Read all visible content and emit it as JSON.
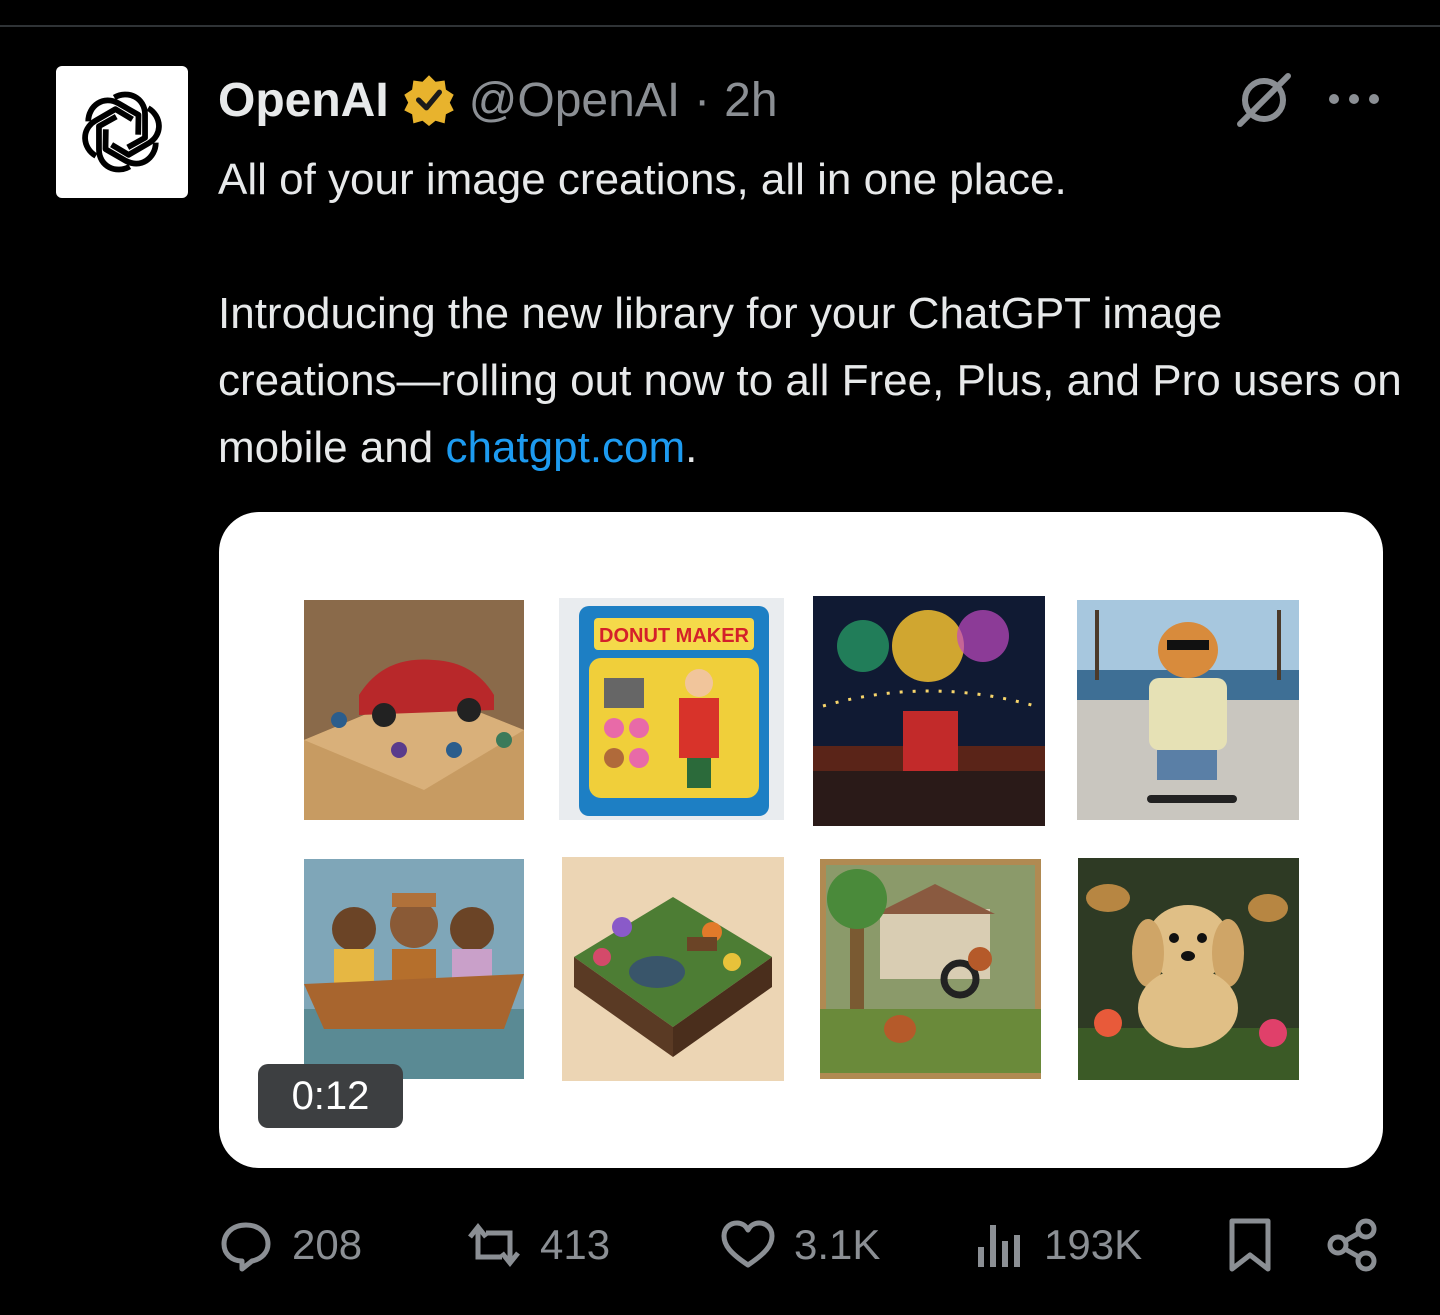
{
  "author": {
    "display_name": "OpenAI",
    "handle": "@OpenAI",
    "separator": "·",
    "time": "2h",
    "avatar_icon": "openai-logo-icon",
    "verified_icon": "verified-badge-icon",
    "verified_color": "#e8b32d"
  },
  "tweet": {
    "line1": "All of your image creations, all in one place.",
    "body_before_link": "Introducing the new library for your ChatGPT image creations—rolling out now to all Free, Plus, and Pro users on mobile and ",
    "link_text": "chatgpt.com",
    "body_after_link": ".",
    "link_color": "#1d9bf0"
  },
  "media": {
    "duration": "0:12",
    "thumbnails": [
      {
        "name": "thumb-car-miniature"
      },
      {
        "name": "thumb-donut-maker",
        "label": "DONUT MAKER"
      },
      {
        "name": "thumb-fireworks-festival"
      },
      {
        "name": "thumb-cat-skateboard"
      },
      {
        "name": "thumb-family-boat"
      },
      {
        "name": "thumb-garden-diorama"
      },
      {
        "name": "thumb-squirrel-diorama"
      },
      {
        "name": "thumb-puppy-figurine"
      }
    ]
  },
  "actions": {
    "replies": "208",
    "reposts": "413",
    "likes": "3.1K",
    "views": "193K"
  },
  "icons": {
    "header_right": [
      "grok-icon",
      "more-icon"
    ],
    "action_bar": [
      "reply-icon",
      "repost-icon",
      "like-icon",
      "views-icon",
      "bookmark-icon",
      "share-icon"
    ]
  }
}
